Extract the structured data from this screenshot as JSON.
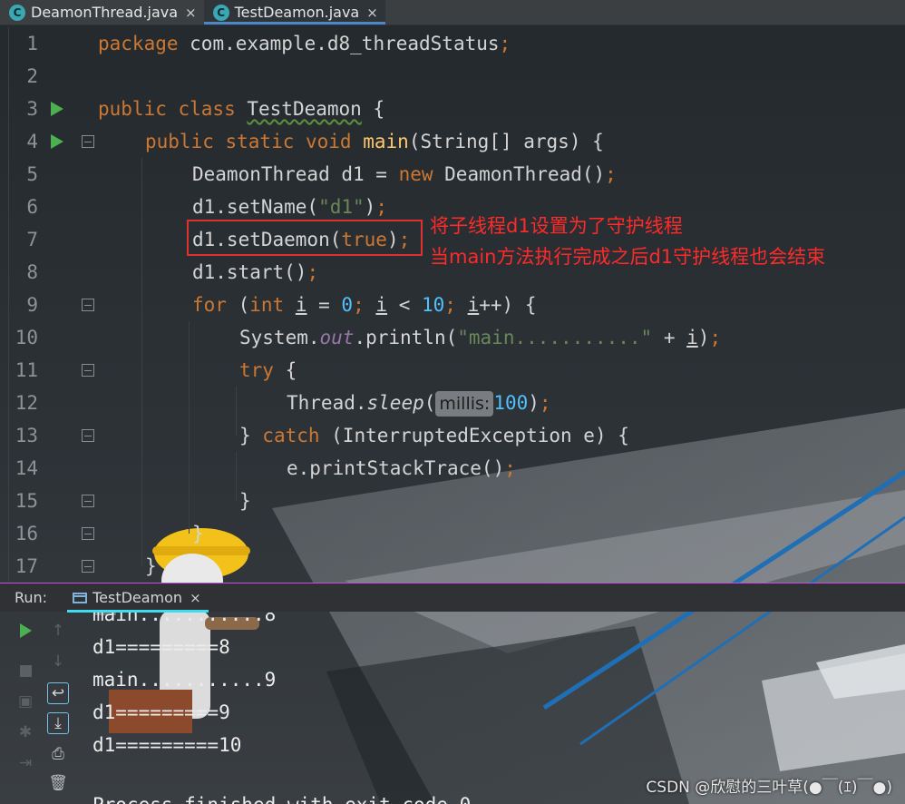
{
  "tabs": [
    {
      "icon": "C",
      "label": "DeamonThread.java",
      "close": "×",
      "active": false
    },
    {
      "icon": "C",
      "label": "TestDeamon.java",
      "close": "×",
      "active": true
    }
  ],
  "editor": {
    "line_numbers": [
      "1",
      "2",
      "3",
      "4",
      "5",
      "6",
      "7",
      "8",
      "9",
      "10",
      "11",
      "12",
      "13",
      "14",
      "15",
      "16",
      "17"
    ],
    "code": {
      "l1_kw": "package",
      "l1_rest": " com.example.d8_threadStatus",
      "l1_semi": ";",
      "l3_kw": "public class",
      "l3_name": "TestDeamon",
      "l3_brace": " {",
      "l4_kw": "public static void",
      "l4_fn": "main",
      "l4_rest": "(String[] args) {",
      "l5_a": "DeamonThread d1 = ",
      "l5_kw": "new",
      "l5_b": " DeamonThread()",
      "l5_semi": ";",
      "l6_a": "d1.setName(",
      "l6_str": "\"d1\"",
      "l6_b": ")",
      "l6_semi": ";",
      "l7_a": "d1.setDaemon(",
      "l7_kw": "true",
      "l7_b": ")",
      "l7_semi": ";",
      "l8_a": "d1.start()",
      "l8_semi": ";",
      "l9_kw": "for",
      "l9_a": " (",
      "l9_kw2": "int",
      "l9_i1": "i",
      "l9_b": " = ",
      "l9_n0": "0",
      "l9_s1": ";",
      "l9_i2": "i",
      "l9_c": " < ",
      "l9_n10": "10",
      "l9_s2": ";",
      "l9_i3": "i",
      "l9_d": "++) {",
      "l10_a": "System.",
      "l10_out": "out",
      "l10_b": ".println(",
      "l10_str": "\"main...........\"",
      "l10_c": " + ",
      "l10_i": "i",
      "l10_d": ")",
      "l10_semi": ";",
      "l11_kw": "try",
      "l11_b": " {",
      "l12_a": "Thread.",
      "l12_sleep": "sleep",
      "l12_b": "(",
      "l12_hint": "millis:",
      "l12_num": "100",
      "l12_c": ")",
      "l12_semi": ";",
      "l13_a": "} ",
      "l13_kw": "catch",
      "l13_b": " (InterruptedException e) {",
      "l14_a": "e.printStackTrace()",
      "l14_semi": ";",
      "l15": "}",
      "l16": "}",
      "l17": "}"
    }
  },
  "annotation": {
    "line1": "将子线程d1设置为了守护线程",
    "line2": "当main方法执行完成之后d1守护线程也会结束"
  },
  "run_panel": {
    "label": "Run:",
    "tab": {
      "label": "TestDeamon",
      "close": "×"
    },
    "output": [
      "main...........8",
      "d1=========8",
      "main...........9",
      "d1=========9",
      "d1=========10",
      "Process finished with exit code 0"
    ]
  },
  "watermark": "CSDN @欣慰的三叶草(●￣(ｴ)￣●)",
  "colors": {
    "keyword": "#cc7832",
    "string": "#6a8759",
    "number": "#4fc1ff",
    "annotation": "#ff2a2a",
    "run_green": "#4caf50"
  }
}
